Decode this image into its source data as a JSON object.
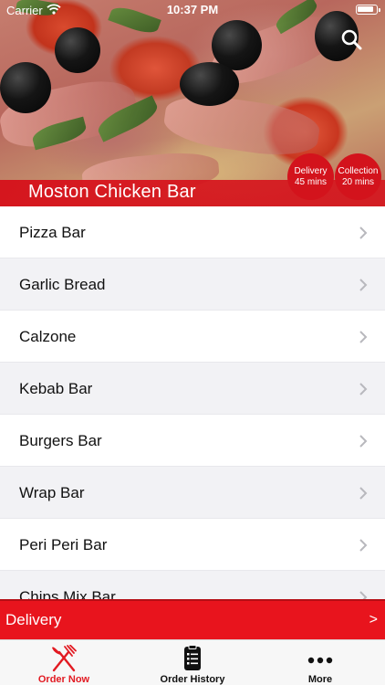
{
  "status_bar": {
    "carrier": "Carrier",
    "time": "10:37 PM"
  },
  "header": {
    "restaurant_name": "Moston Chicken Bar",
    "delivery": {
      "label": "Delivery",
      "time": "45 mins"
    },
    "collection": {
      "label": "Collection",
      "time": "20 mins"
    },
    "search_icon": "search-icon"
  },
  "categories": [
    {
      "label": "Pizza Bar"
    },
    {
      "label": "Garlic Bread"
    },
    {
      "label": "Calzone"
    },
    {
      "label": "Kebab Bar"
    },
    {
      "label": "Burgers Bar"
    },
    {
      "label": "Wrap Bar"
    },
    {
      "label": "Peri Peri Bar"
    },
    {
      "label": "Chips Mix Bar"
    }
  ],
  "order_mode_bar": {
    "label": "Delivery",
    "arrow": ">"
  },
  "tabs": [
    {
      "label": "Order Now",
      "icon": "fork-knife-icon",
      "active": true
    },
    {
      "label": "Order History",
      "icon": "receipt-icon",
      "active": false
    },
    {
      "label": "More",
      "icon": "more-dots-icon",
      "active": false
    }
  ],
  "colors": {
    "accent": "#e21a22",
    "row_alt": "#f2f2f5"
  }
}
